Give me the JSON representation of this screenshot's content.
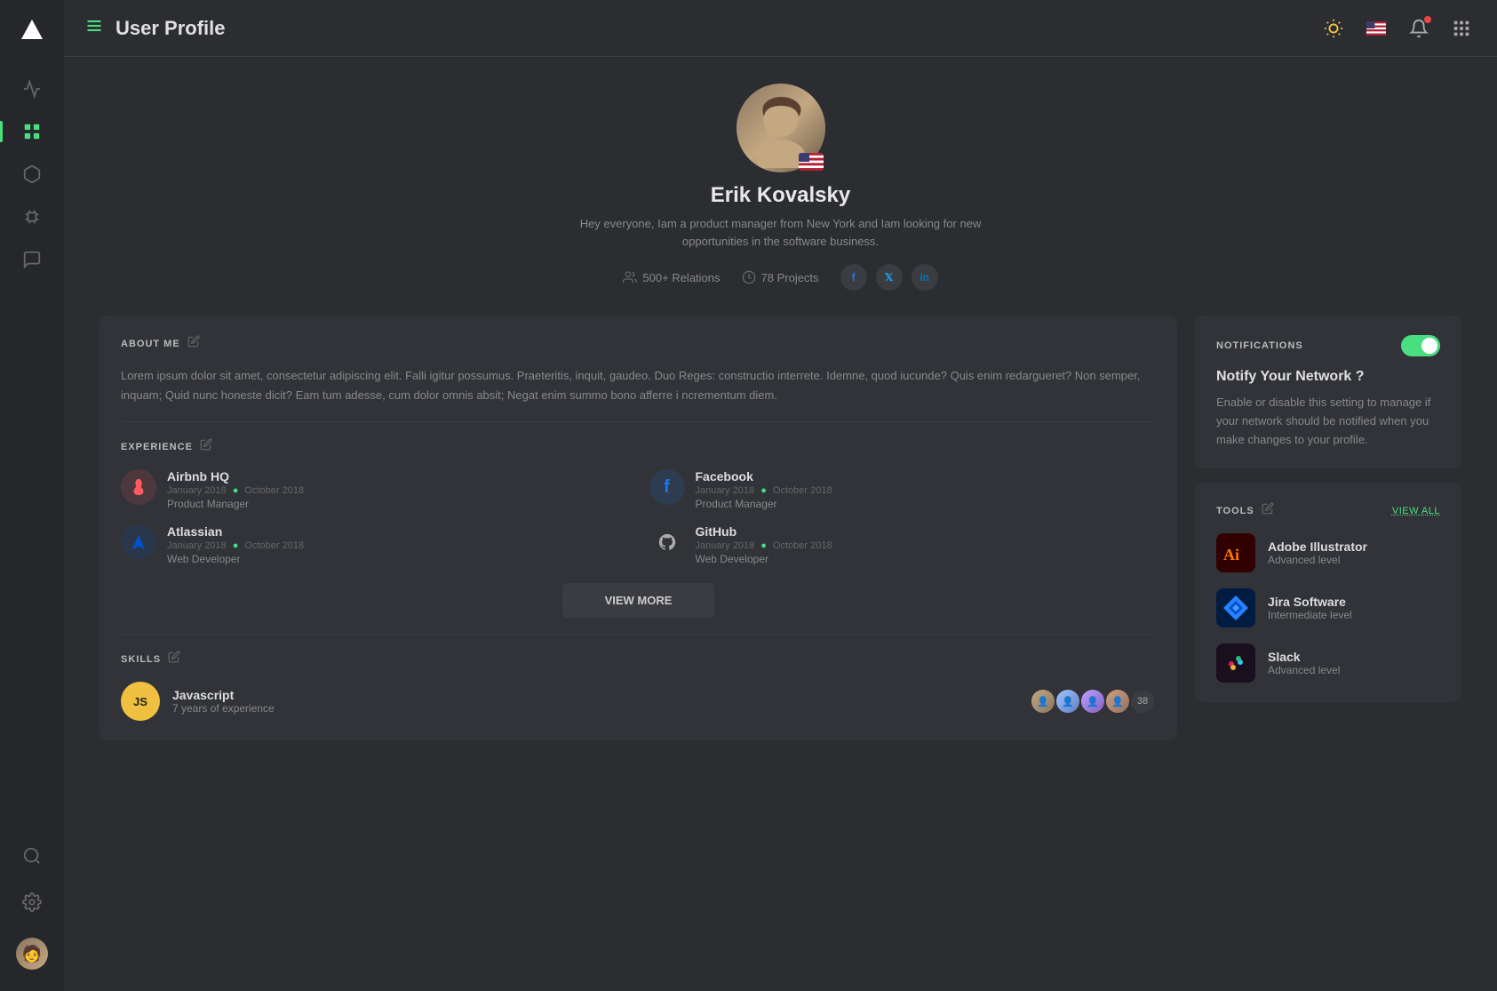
{
  "header": {
    "title": "User Profile",
    "menu_label": "menu"
  },
  "sidebar": {
    "items": [
      {
        "id": "activity",
        "label": "Activity"
      },
      {
        "id": "dashboard",
        "label": "Dashboard",
        "active": true
      },
      {
        "id": "cube",
        "label": "3D/Models"
      },
      {
        "id": "chip",
        "label": "Integrations"
      },
      {
        "id": "chat",
        "label": "Messages"
      },
      {
        "id": "search",
        "label": "Search"
      },
      {
        "id": "settings",
        "label": "Settings"
      }
    ]
  },
  "profile": {
    "name": "Erik Kovalsky",
    "bio": "Hey everyone,  Iam a product manager from New York and Iam looking for new opportunities in the software business.",
    "relations": "500+ Relations",
    "projects": "78 Projects",
    "socials": [
      "f",
      "t",
      "in"
    ]
  },
  "about": {
    "title": "ABOUT ME",
    "text": "Lorem ipsum dolor sit amet, consectetur adipiscing elit. Falli igitur possumus. Praeteritis, inquit, gaudeo. Duo Reges: constructio interrete. Idemne, quod iucunde? Quis enim redargueret? Non semper, inquam; Quid nunc honeste dicit? Eam tum adesse, cum dolor omnis absit; Negat enim summo bono afferre i ncrementum diem."
  },
  "experience": {
    "title": "EXPERIENCE",
    "items": [
      {
        "company": "Airbnb HQ",
        "start": "January 2018",
        "end": "October 2018",
        "role": "Product Manager",
        "logo": "✦",
        "color": "#ff5a5f"
      },
      {
        "company": "Facebook",
        "start": "January 2018",
        "end": "October 2018",
        "role": "Product Manager",
        "logo": "f",
        "color": "#1877f2"
      },
      {
        "company": "Atlassian",
        "start": "January 2018",
        "end": "October 2018",
        "role": "Web Developer",
        "logo": "▲",
        "color": "#0052cc"
      },
      {
        "company": "GitHub",
        "start": "January 2018",
        "end": "October 2018",
        "role": "Web Developer",
        "logo": "●",
        "color": "#aaa"
      }
    ],
    "view_more": "VIEW MORE"
  },
  "skills": {
    "title": "SKILLS",
    "items": [
      {
        "name": "Javascript",
        "exp": "7 years of experience",
        "badge": "JS",
        "endorser_count": "38"
      }
    ]
  },
  "notifications": {
    "title": "NOTIFICATIONS",
    "section_title": "Notify Your Network ?",
    "description": "Enable or disable this setting to manage if your network should be notified when you make changes to your profile.",
    "enabled": true
  },
  "tools": {
    "title": "TOOLS",
    "view_all": "VIEW ALL",
    "items": [
      {
        "name": "Adobe Illustrator",
        "level": "Advanced level",
        "color": "#ff7700",
        "bg": "#2a1a00",
        "icon": "Ai"
      },
      {
        "name": "Jira Software",
        "level": "Intermediate level",
        "color": "#2684ff",
        "bg": "#001733",
        "icon": "◆"
      },
      {
        "name": "Slack",
        "level": "Advanced level",
        "color": "#4a154b",
        "bg": "#1a0a1a",
        "icon": "#"
      }
    ]
  }
}
